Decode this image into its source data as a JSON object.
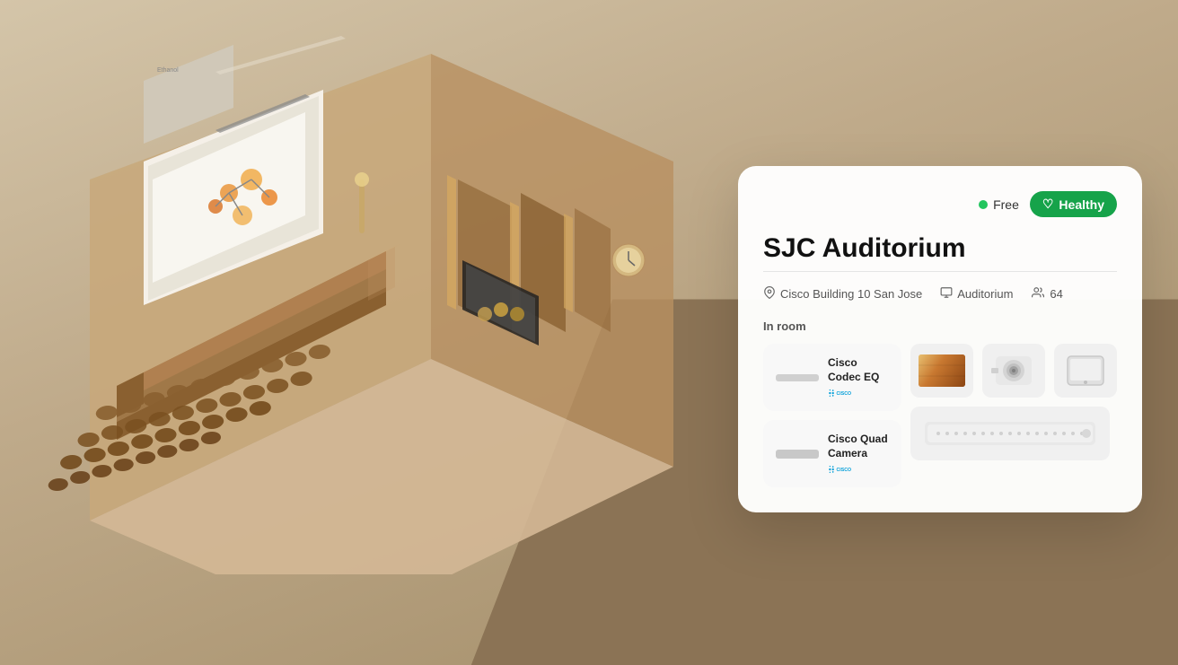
{
  "background": {
    "top_color": "#d4c5a9",
    "bottom_color": "#8b7355"
  },
  "card": {
    "status_free_label": "Free",
    "status_healthy_label": "Healthy",
    "room_name": "SJC Auditorium",
    "location": "Cisco Building 10 San Jose",
    "room_type": "Auditorium",
    "capacity": "64",
    "in_room_label": "In room",
    "devices": [
      {
        "name": "Cisco Codec EQ",
        "brand": "cisco",
        "type": "codec"
      },
      {
        "name": "Cisco Quad Camera",
        "brand": "cisco",
        "type": "camera"
      }
    ],
    "thumbnails": [
      {
        "type": "screen",
        "label": "screen"
      },
      {
        "type": "camera",
        "label": "camera-unit"
      },
      {
        "type": "tablet",
        "label": "touch-panel"
      },
      {
        "type": "speaker",
        "label": "speaker"
      }
    ]
  },
  "icons": {
    "location_pin": "📍",
    "building": "🏢",
    "people": "👥",
    "heart_check": "♡",
    "cisco_dots": "⠿⠿"
  }
}
